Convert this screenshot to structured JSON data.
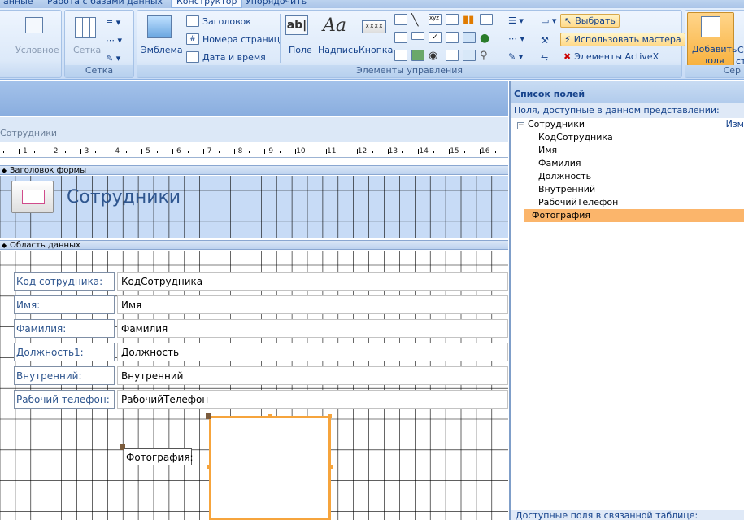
{
  "ribbon": {
    "tabs": [
      {
        "label": "анные",
        "active": false
      },
      {
        "label": "Работа с базами данных",
        "active": false
      },
      {
        "label": "Конструктор",
        "active": true
      },
      {
        "label": "Упорядочить",
        "active": false
      }
    ],
    "groups": {
      "grid": {
        "label": "Сетка",
        "conditional": "Условное",
        "grid_button": "Сетка"
      },
      "controls": {
        "label": "Элементы управления",
        "emblem": "Эмблема",
        "header": "Заголовок",
        "page_numbers": "Номера страниц",
        "date_time": "Дата и время",
        "field": "Поле",
        "caption": "Надпись",
        "button": "Кнопка",
        "select": "Выбрать",
        "use_wizards": "Использовать мастера",
        "activex": "Элементы ActiveX"
      },
      "tools": {
        "label": "Сер",
        "add_fields": "Добавить поля",
        "add_fields_line1": "Добавить",
        "add_fields_line2": "поля",
        "st": "Ст",
        "st2": "сти"
      }
    }
  },
  "form": {
    "doc_title": "Сотрудники",
    "sections": {
      "header": "Заголовок формы",
      "detail": "Область данных"
    },
    "form_title": "Сотрудники",
    "ruler_marks": [
      "1",
      "2",
      "3",
      "4",
      "5",
      "6",
      "7",
      "8",
      "9",
      "10",
      "11",
      "12",
      "13",
      "14",
      "15",
      "16"
    ],
    "rows": [
      {
        "label": "Код сотрудника:",
        "field": "КодСотрудника"
      },
      {
        "label": "Имя:",
        "field": "Имя"
      },
      {
        "label": "Фамилия:",
        "field": "Фамилия"
      },
      {
        "label": "Должность1:",
        "field": "Должность"
      },
      {
        "label": "Внутренний:",
        "field": "Внутренний"
      },
      {
        "label": "Рабочий телефон:",
        "field": "РабочийТелефон"
      }
    ],
    "photo_label": "Фотография:"
  },
  "field_list": {
    "title": "Список полей",
    "subtitle": "Поля, доступные в данном представлении:",
    "table": "Сотрудники",
    "edit": "Изм",
    "fields": [
      "КодСотрудника",
      "Имя",
      "Фамилия",
      "Должность",
      "Внутренний",
      "РабочийТелефон",
      "Фотография"
    ],
    "selected": "Фотография",
    "bottom": "Доступные поля в связанной таблице:"
  },
  "colors": {
    "accent": "#f6a43c",
    "selection": "#fbb56b",
    "ribbon_text": "#15428b"
  }
}
